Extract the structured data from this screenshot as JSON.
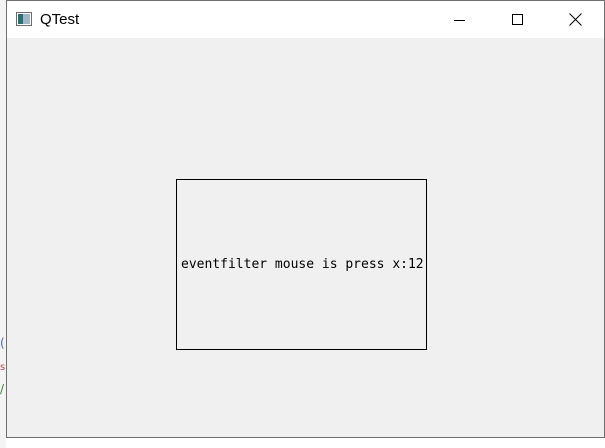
{
  "window": {
    "title": "QTest",
    "icon": "window-app-icon"
  },
  "caption_buttons": {
    "minimize": "minimize-icon",
    "maximize": "maximize-icon",
    "close": "close-icon"
  },
  "event_label": {
    "text": "eventfilter mouse is press x:12"
  },
  "colors": {
    "titlebar": "#ffffff",
    "client_background": "#f0f0f0",
    "window_border": "#6f6f6f",
    "box_border": "#000000"
  }
}
